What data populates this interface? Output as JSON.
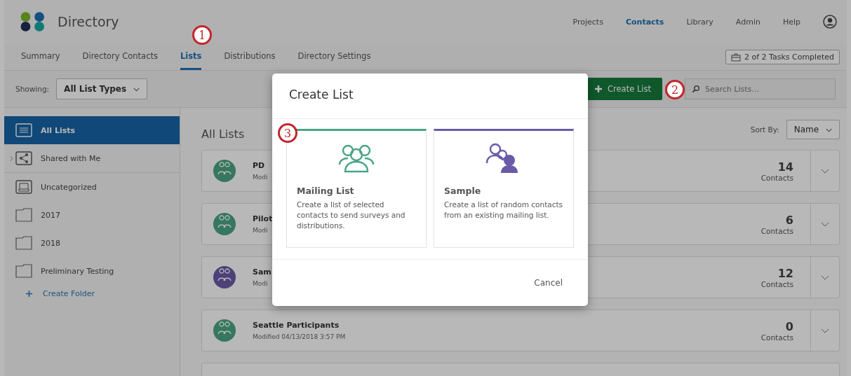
{
  "app": {
    "title": "Directory"
  },
  "nav": [
    {
      "label": "Projects",
      "selected": false
    },
    {
      "label": "Contacts",
      "selected": true
    },
    {
      "label": "Library",
      "selected": false
    },
    {
      "label": "Admin",
      "selected": false
    },
    {
      "label": "Help",
      "selected": false
    }
  ],
  "tabs": [
    {
      "label": "Summary",
      "selected": false
    },
    {
      "label": "Directory Contacts",
      "selected": false
    },
    {
      "label": "Lists",
      "selected": true
    },
    {
      "label": "Distributions",
      "selected": false
    },
    {
      "label": "Directory Settings",
      "selected": false
    }
  ],
  "tasks_badge": "2 of 2 Tasks Completed",
  "toolbar": {
    "showing_label": "Showing:",
    "filter": "All List Types",
    "create_button": "Create List",
    "search": {
      "placeholder": "Search Lists..."
    }
  },
  "sidebar": {
    "items": [
      {
        "label": "All Lists",
        "kind": "list",
        "selected": true,
        "expandable": false
      },
      {
        "label": "Shared with Me",
        "kind": "shared",
        "selected": false,
        "expandable": true
      },
      {
        "label": "Uncategorized",
        "kind": "inbox",
        "selected": false,
        "expandable": false
      },
      {
        "label": "2017",
        "kind": "folder",
        "selected": false,
        "expandable": false
      },
      {
        "label": "2018",
        "kind": "folder",
        "selected": false,
        "expandable": false
      },
      {
        "label": "Preliminary Testing",
        "kind": "folder",
        "selected": false,
        "expandable": false
      }
    ],
    "create_folder": "Create Folder"
  },
  "main": {
    "heading": "All Lists",
    "sort_label": "Sort By:",
    "sort_value": "Name",
    "rows": [
      {
        "name": "PD",
        "modified": "Modi",
        "count": "14",
        "unit": "Contacts",
        "kind": "mailing"
      },
      {
        "name": "Pilot",
        "modified": "Modi",
        "count": "6",
        "unit": "Contacts",
        "kind": "mailing"
      },
      {
        "name": "Sam",
        "modified": "Modi",
        "count": "12",
        "unit": "Contacts",
        "kind": "sample"
      },
      {
        "name": "Seattle Participants",
        "modified": "Modified 04/13/2018 3:57 PM",
        "count": "0",
        "unit": "Contacts",
        "kind": "mailing"
      }
    ]
  },
  "modal": {
    "title": "Create List",
    "options": [
      {
        "kind": "mailing",
        "title": "Mailing List",
        "description": "Create a list of selected contacts to send surveys and distributions."
      },
      {
        "kind": "sample",
        "title": "Sample",
        "description": "Create a list of random contacts from an existing mailing list."
      }
    ],
    "cancel": "Cancel"
  },
  "callouts": [
    "1",
    "2",
    "3"
  ]
}
